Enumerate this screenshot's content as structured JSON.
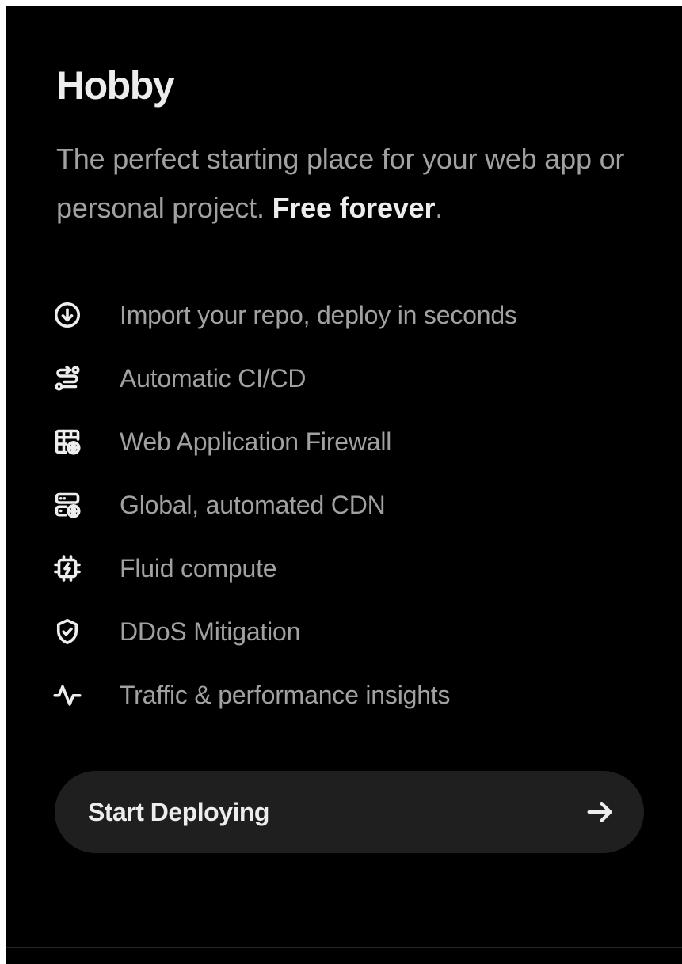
{
  "plan": {
    "title": "Hobby",
    "description_lead": "The perfect starting place for your web app or personal project. ",
    "description_emphasis": "Free forever",
    "description_tail": "."
  },
  "features": [
    {
      "icon": "arrow-down-circle-icon",
      "label": "Import your repo, deploy in seconds"
    },
    {
      "icon": "git-pipeline-icon",
      "label": "Automatic CI/CD"
    },
    {
      "icon": "firewall-globe-icon",
      "label": "Web Application Firewall"
    },
    {
      "icon": "server-globe-icon",
      "label": "Global, automated CDN"
    },
    {
      "icon": "cpu-chip-icon",
      "label": "Fluid compute"
    },
    {
      "icon": "shield-check-icon",
      "label": "DDoS Mitigation"
    },
    {
      "icon": "activity-pulse-icon",
      "label": "Traffic & performance insights"
    }
  ],
  "cta": {
    "label": "Start Deploying",
    "icon": "arrow-right-icon"
  },
  "colors": {
    "background": "#000000",
    "heading": "#ededed",
    "body_text": "#a1a1a1",
    "button_background": "#1f1f1f"
  }
}
